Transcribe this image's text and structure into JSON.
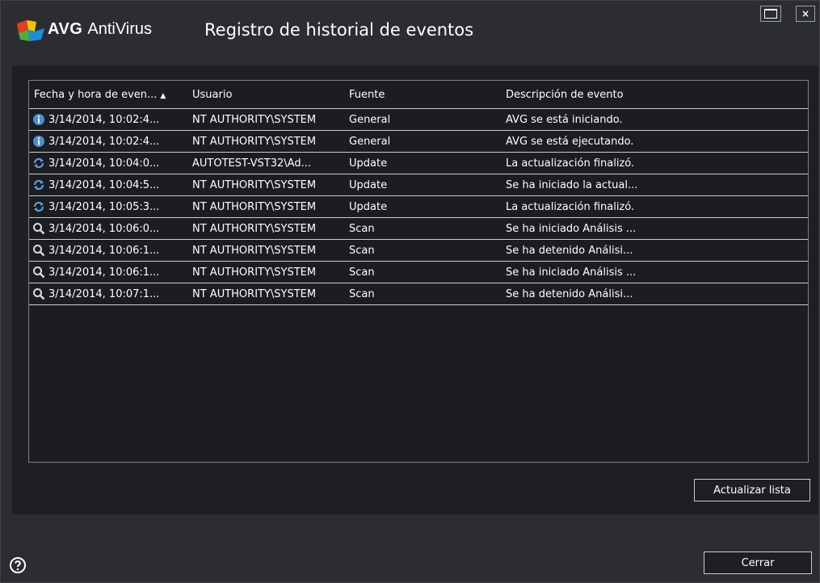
{
  "window": {
    "brand": "AVG",
    "product": "AntiVirus",
    "title": "Registro de historial de eventos",
    "maximize_icon": "maximize-icon",
    "close_label": "×"
  },
  "table": {
    "headers": [
      "Fecha y hora de even...",
      "Usuario",
      "Fuente",
      "Descripción de evento"
    ],
    "sort_indicator": "▲",
    "rows": [
      {
        "icon": "info-icon",
        "date": "3/14/2014, 10:02:4...",
        "user": "NT AUTHORITY\\SYSTEM",
        "source": "General",
        "description": "AVG se está iniciando."
      },
      {
        "icon": "info-icon",
        "date": "3/14/2014, 10:02:4...",
        "user": "NT AUTHORITY\\SYSTEM",
        "source": "General",
        "description": "AVG se está ejecutando."
      },
      {
        "icon": "update-icon",
        "date": "3/14/2014, 10:04:0...",
        "user": "AUTOTEST-VST32\\Ad...",
        "source": "Update",
        "description": "La actualización finalizó."
      },
      {
        "icon": "update-icon",
        "date": "3/14/2014, 10:04:5...",
        "user": "NT AUTHORITY\\SYSTEM",
        "source": "Update",
        "description": "Se ha iniciado la actual..."
      },
      {
        "icon": "update-icon",
        "date": "3/14/2014, 10:05:3...",
        "user": "NT AUTHORITY\\SYSTEM",
        "source": "Update",
        "description": "La actualización finalizó."
      },
      {
        "icon": "scan-icon",
        "date": "3/14/2014, 10:06:0...",
        "user": "NT AUTHORITY\\SYSTEM",
        "source": "Scan",
        "description": "Se ha iniciado Análisis ..."
      },
      {
        "icon": "scan-icon",
        "date": "3/14/2014, 10:06:1...",
        "user": "NT AUTHORITY\\SYSTEM",
        "source": "Scan",
        "description": "Se ha detenido Análisi..."
      },
      {
        "icon": "scan-icon",
        "date": "3/14/2014, 10:06:1...",
        "user": "NT AUTHORITY\\SYSTEM",
        "source": "Scan",
        "description": "Se ha iniciado Análisis ..."
      },
      {
        "icon": "scan-icon",
        "date": "3/14/2014, 10:07:1...",
        "user": "NT AUTHORITY\\SYSTEM",
        "source": "Scan",
        "description": "Se ha detenido Análisi..."
      }
    ]
  },
  "buttons": {
    "refresh": "Actualizar lista",
    "close": "Cerrar"
  },
  "help_icon": "help-icon",
  "colors": {
    "background": "#2b2d31",
    "panel": "#1e1f23",
    "info_icon": "#4a8fd6",
    "update_icon": "#5b9ee0",
    "scan_icon": "#d8dce2",
    "logo_red": "#e23c26",
    "logo_yellow": "#f5c400",
    "logo_green": "#4caf3c",
    "logo_blue": "#1d8ed8"
  }
}
